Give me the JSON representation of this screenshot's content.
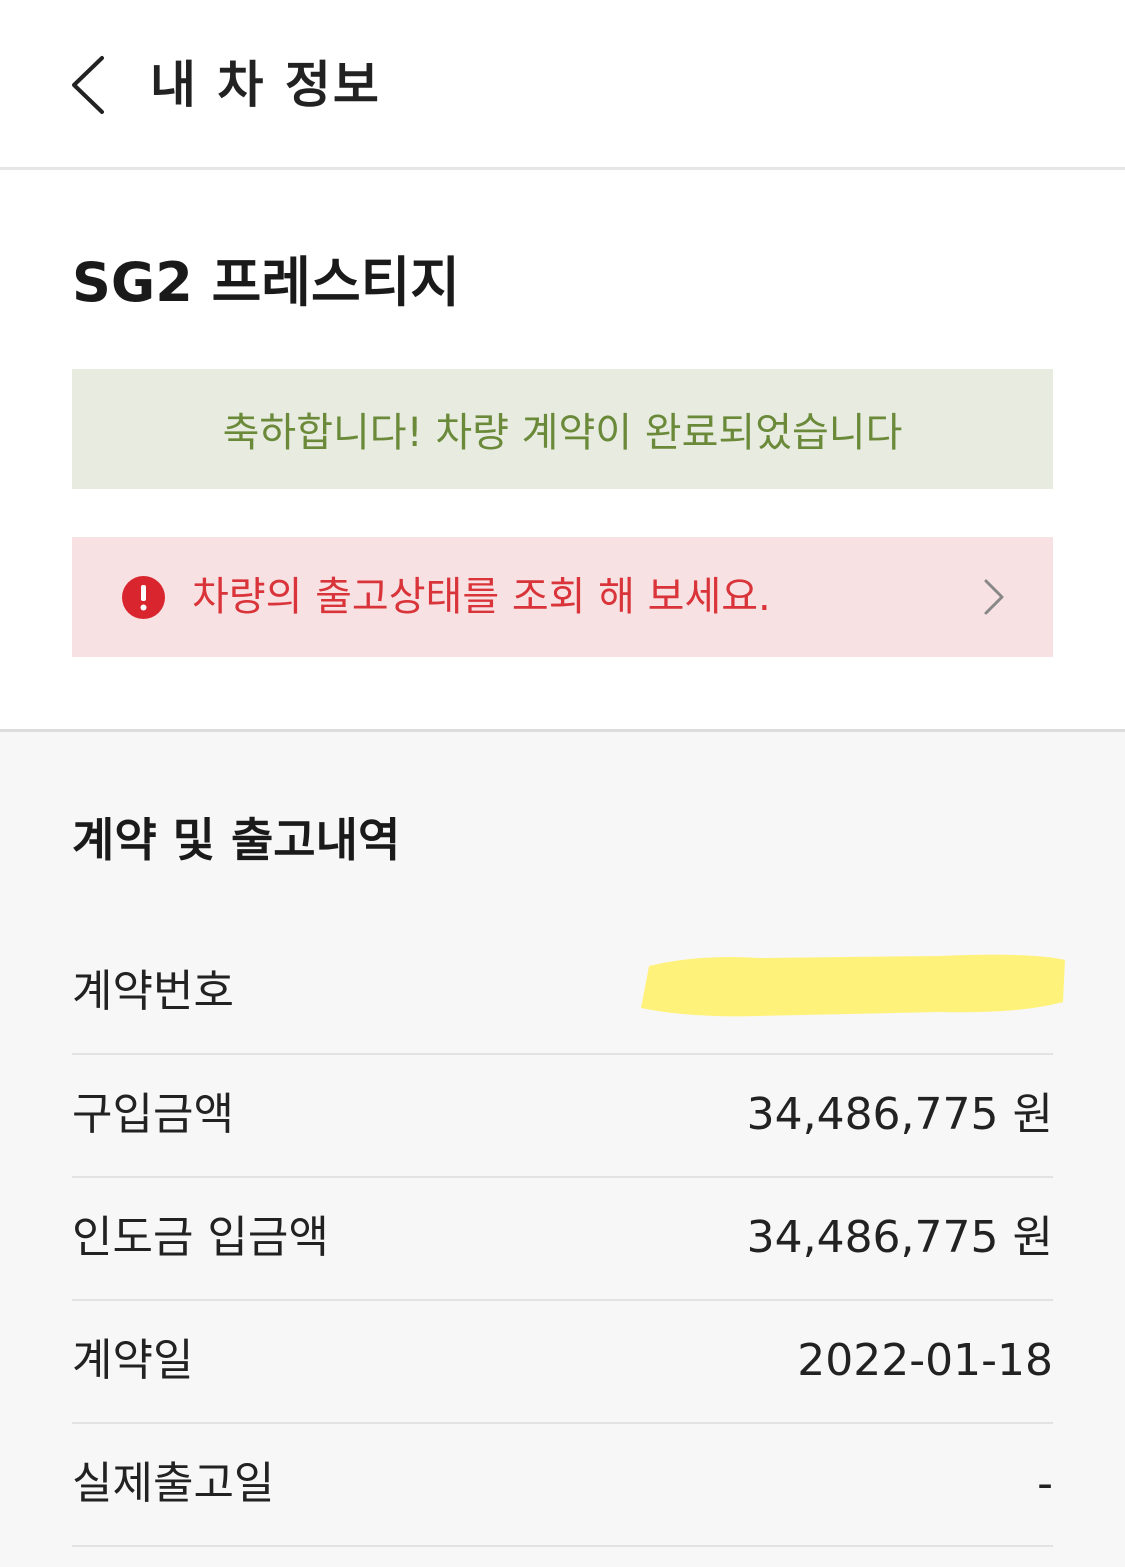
{
  "header": {
    "back_icon": "chevron-left-icon",
    "title": "내 차 정보"
  },
  "car": {
    "name": "SG2 프레스티지"
  },
  "notices": {
    "success": {
      "text": "축하합니다! 차량 계약이 완료되었습니다",
      "text_color": "#6a8a3a",
      "bg_color": "#e8ebe0"
    },
    "alert": {
      "icon": "exclamation-circle-icon",
      "text": "차량의 출고상태를 조회 해 보세요.",
      "chevron": "chevron-right-icon",
      "text_color": "#d9343a",
      "bg_color": "#f8e1e3"
    }
  },
  "contract": {
    "title": "계약 및 출고내역",
    "rows": [
      {
        "label": "계약번호",
        "value": "",
        "redacted": true,
        "redaction_color": "#fff27a"
      },
      {
        "label": "구입금액",
        "value": "34,486,775 원"
      },
      {
        "label": "인도금 입금액",
        "value": "34,486,775 원"
      },
      {
        "label": "계약일",
        "value": "2022-01-18"
      },
      {
        "label": "실제출고일",
        "value": "-"
      }
    ]
  }
}
